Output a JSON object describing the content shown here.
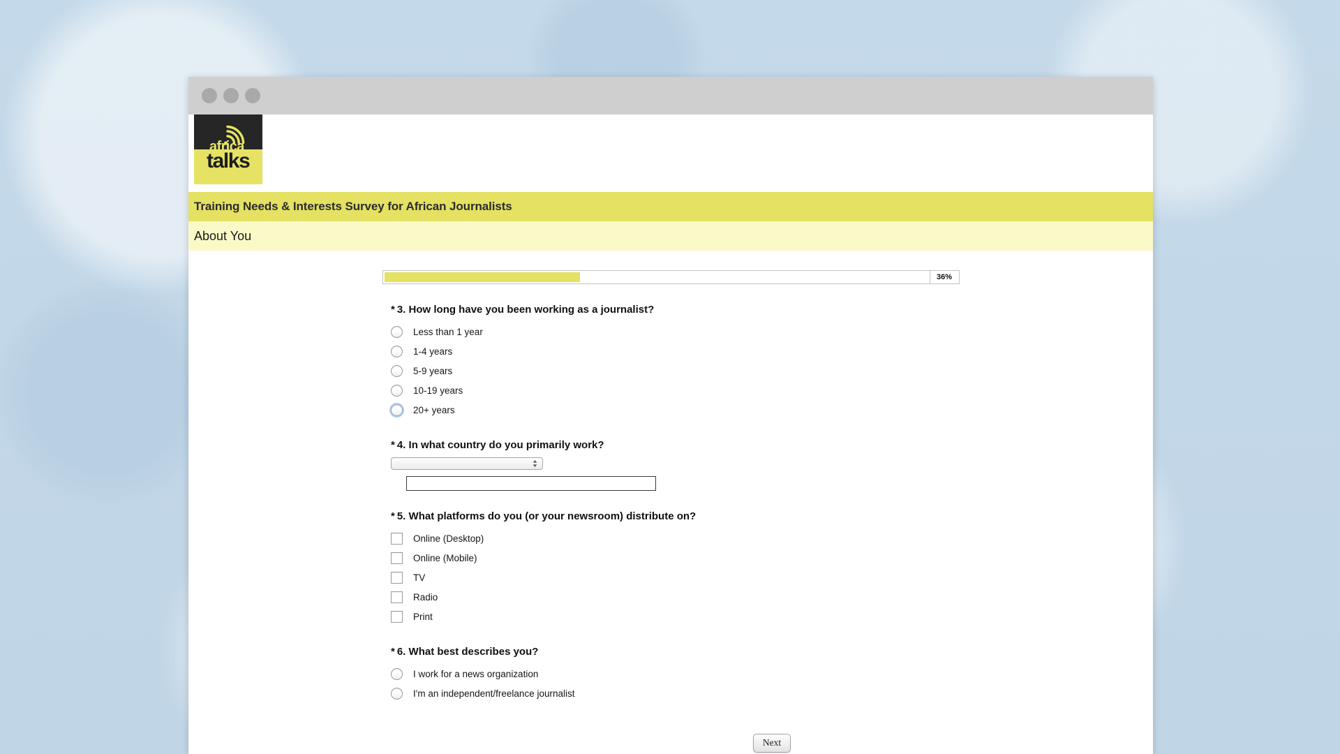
{
  "window": {
    "dots": [
      "close-dot",
      "minimize-dot",
      "maximize-dot"
    ]
  },
  "brand": {
    "logo_line1": "africa",
    "logo_line2": "talks",
    "logo_dark": "#262626",
    "logo_yellow": "#e6e364"
  },
  "header": {
    "survey_title": "Training Needs & Interests Survey for African Journalists",
    "section_title": "About You",
    "title_bg": "#e4e163",
    "section_bg": "#fafac8"
  },
  "progress": {
    "percent_label": "36%",
    "percent_value": 36,
    "fill_color": "#e4e163"
  },
  "questions": [
    {
      "id": "q3",
      "required_marker": "*",
      "number": "3.",
      "text": "How long have you been working as a journalist?",
      "type": "radio",
      "options": [
        {
          "label": "Less than 1 year",
          "focused": false
        },
        {
          "label": "1-4 years",
          "focused": false
        },
        {
          "label": "5-9 years",
          "focused": false
        },
        {
          "label": "10-19 years",
          "focused": false
        },
        {
          "label": "20+ years",
          "focused": true
        }
      ]
    },
    {
      "id": "q4",
      "required_marker": "*",
      "number": "4.",
      "text": "In what country do you primarily work?",
      "type": "select-and-text",
      "select_value": "",
      "select_placeholder": "",
      "text_value": "",
      "text_placeholder": ""
    },
    {
      "id": "q5",
      "required_marker": "*",
      "number": "5.",
      "text": "What platforms do you (or your newsroom) distribute on?",
      "type": "checkbox",
      "options": [
        {
          "label": "Online (Desktop)"
        },
        {
          "label": "Online (Mobile)"
        },
        {
          "label": "TV"
        },
        {
          "label": "Radio"
        },
        {
          "label": "Print"
        }
      ]
    },
    {
      "id": "q6",
      "required_marker": "*",
      "number": "6.",
      "text": "What best describes you?",
      "type": "radio",
      "options": [
        {
          "label": "I work for a news organization",
          "focused": false
        },
        {
          "label": "I'm an independent/freelance journalist",
          "focused": false
        }
      ]
    }
  ],
  "footer": {
    "next_label": "Next"
  }
}
